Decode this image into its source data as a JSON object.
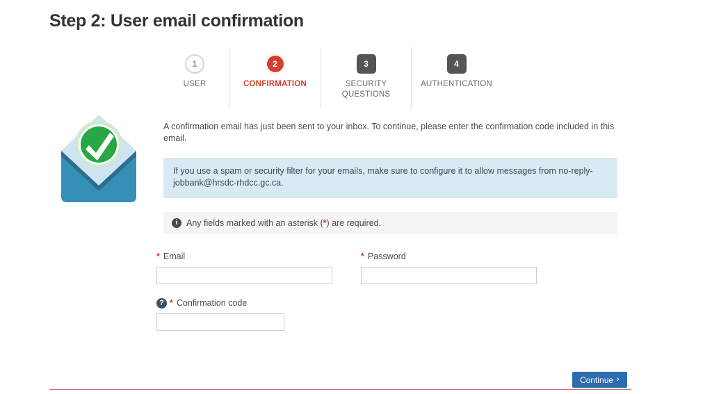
{
  "page": {
    "title": "Step 2: User email confirmation"
  },
  "stepper": {
    "steps": [
      {
        "number": "1",
        "label": "USER",
        "state": "done",
        "marker": "circle-outline"
      },
      {
        "number": "2",
        "label": "CONFIRMATION",
        "state": "active",
        "marker": "circle-filled"
      },
      {
        "number": "3",
        "label": "SECURITY\nQUESTIONS",
        "state": "upcoming",
        "marker": "square"
      },
      {
        "number": "4",
        "label": "AUTHENTICATION",
        "state": "upcoming",
        "marker": "square"
      }
    ]
  },
  "illustration": {
    "name": "email-confirmed-envelope-icon",
    "colors": {
      "envelope_front": "#3690b6",
      "envelope_fold": "#2b6e91",
      "envelope_back": "#cfe4f0",
      "check_circle": "#28a745",
      "check_ring": "#cde9d3",
      "check_mark": "#ffffff"
    }
  },
  "content": {
    "intro": "A confirmation email has just been sent to your inbox. To continue, please enter the confirmation code included in this email.",
    "info_panel": "If you use a spam or security filter for your emails, make sure to configure it to allow messages from no-reply-jobbank@hrsdc-rhdcc.gc.ca.",
    "required_note_before": "Any fields marked with an asterisk (",
    "required_note_asterisk": "*",
    "required_note_after": ") are required.",
    "info_icon_glyph": "i"
  },
  "form": {
    "asterisk": "*",
    "help_glyph": "?",
    "email": {
      "label": "Email",
      "value": "",
      "placeholder": ""
    },
    "password": {
      "label": "Password",
      "value": "",
      "placeholder": ""
    },
    "confirmation_code": {
      "label": "Confirmation code",
      "value": "",
      "placeholder": ""
    }
  },
  "actions": {
    "continue_label": "Continue",
    "continue_chevron": "›"
  },
  "colors": {
    "accent_red": "#d3402f",
    "info_blue_bg": "#daeaf2",
    "note_gray_bg": "#f5f5f5",
    "button_blue": "#2e6cb0",
    "rule_red": "#d36a74",
    "step_square_gray": "#555555"
  }
}
